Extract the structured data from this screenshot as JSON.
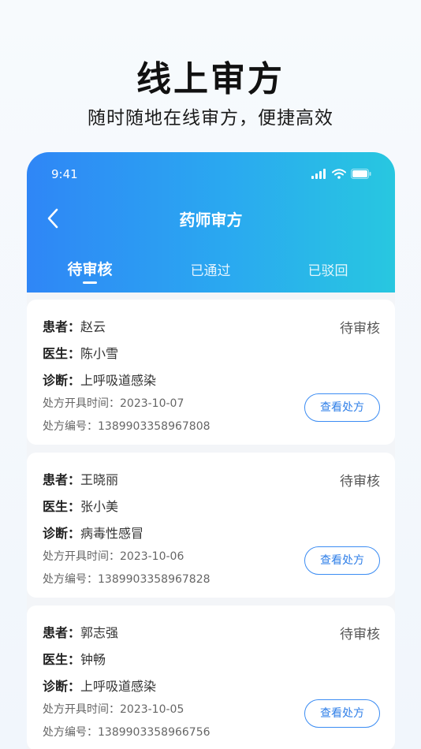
{
  "hero": {
    "title": "线上审方",
    "subtitle": "随时随地在线审方，便捷高效"
  },
  "status_bar": {
    "time": "9:41",
    "icons": [
      "signal-icon",
      "wifi-icon",
      "battery-icon"
    ]
  },
  "nav": {
    "title": "药师审方",
    "back_icon": "chevron-left-icon"
  },
  "tabs": [
    {
      "label": "待审核",
      "active": true
    },
    {
      "label": "已通过",
      "active": false
    },
    {
      "label": "已驳回",
      "active": false
    }
  ],
  "labels": {
    "patient": "患者：",
    "doctor": "医生：",
    "diagnosis": "诊断：",
    "time": "处方开具时间：",
    "number": "处方编号：",
    "view_button": "查看处方"
  },
  "prescriptions": [
    {
      "patient": "赵云",
      "doctor": "陈小雪",
      "diagnosis": "上呼吸道感染",
      "time": "2023-10-07",
      "number": "1389903358967808",
      "status": "待审核"
    },
    {
      "patient": "王晓丽",
      "doctor": "张小美",
      "diagnosis": "病毒性感冒",
      "time": "2023-10-06",
      "number": "1389903358967828",
      "status": "待审核"
    },
    {
      "patient": "郭志强",
      "doctor": "钟畅",
      "diagnosis": "上呼吸道感染",
      "time": "2023-10-05",
      "number": "1389903358966756",
      "status": "待审核"
    }
  ],
  "colors": {
    "header_gradient_start": "#2f86f6",
    "header_gradient_end": "#28c7e0",
    "accent": "#2f7fe8"
  }
}
